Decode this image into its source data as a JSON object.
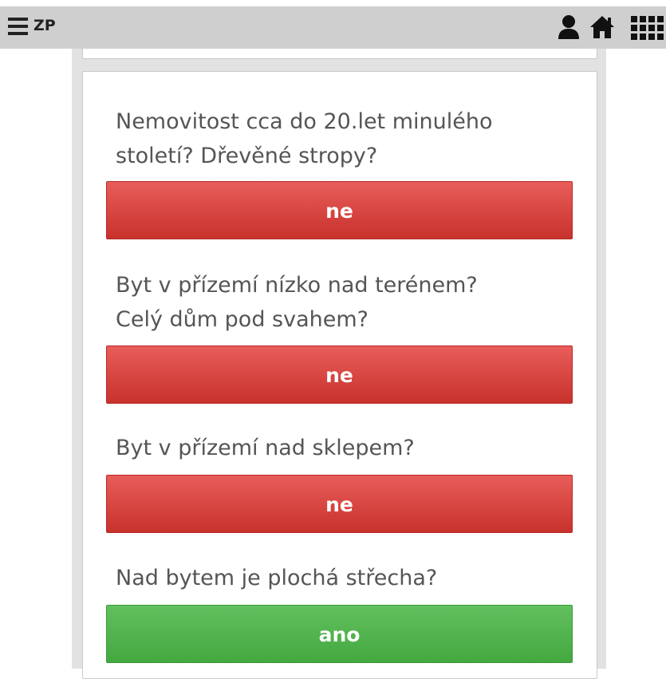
{
  "header": {
    "title": "ZP",
    "icons": [
      "menu-icon",
      "user-icon",
      "home-icon",
      "apps-grid-icon"
    ],
    "background": "#cfcfcf"
  },
  "questions": [
    {
      "lines": [
        "Nemovitost cca do 20.let minulého",
        "století? Dřevěné stropy?"
      ],
      "answer": "ne",
      "answer_color": "#d9443f"
    },
    {
      "lines": [
        "Byt v přízemí nízko nad terénem?",
        "Celý dům pod svahem?"
      ],
      "answer": "ne",
      "answer_color": "#d9443f"
    },
    {
      "lines": [
        "Byt v přízemí nad sklepem?"
      ],
      "answer": "ne",
      "answer_color": "#d9443f"
    },
    {
      "lines": [
        "Nad bytem je plochá střecha?"
      ],
      "answer": "ano",
      "answer_color": "#52b44e"
    }
  ]
}
